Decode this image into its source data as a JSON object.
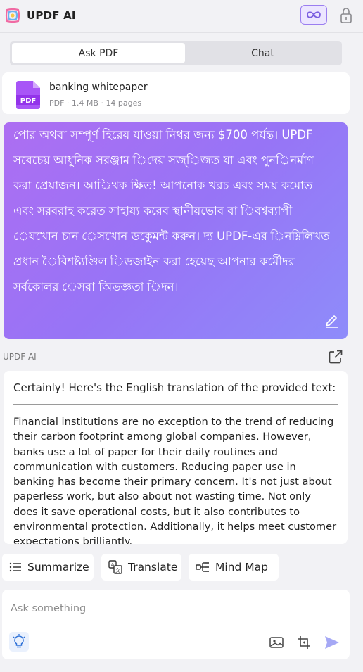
{
  "header": {
    "app_title": "UPDF AI"
  },
  "tabs": [
    {
      "label": "Ask PDF",
      "active": true
    },
    {
      "label": "Chat",
      "active": false
    }
  ],
  "file": {
    "name": "banking whitepaper",
    "meta": "PDF · 1.4 MB · 14 pages",
    "icon_label": "PDF"
  },
  "user_message": {
    "lines": [
      "পোর অথবা সম্পূর্ণ হিরেয় যাওয়া নিথর জন্য $700 পর্যন্ত। UPDF",
      "সবেচেয় আধুনিক সরঞ্জাম িদেয় সজ্িজত যা এবং পুনর্িনর্মাণ",
      "করা প্রেয়াজন। আর্িথক ক্ষিত! আপনােক খরচ এবং সময় কমােত",
      "এবং সরবরাহ করেত সাহায্য করেব স্থানীয়ভােব বা িবশ্বব্যাপী",
      "েযখােন চান েসখােন ডকুেমন্ট করুন। দ্য UPDF-এর িনম্নিলিখত",
      "প্রধান ৈবিশষ্ট্যগুিল িডজাইন করা হেয়েছ আপনার কর্মীেদর",
      "সর্বকােলর েসরা অিভজ্ঞতা িদন।"
    ]
  },
  "ai_response": {
    "label": "UPDF AI",
    "intro": "Certainly! Here's the English translation of the provided text:",
    "body": "Financial institutions are no exception to the trend of reducing their carbon footprint among global companies. However, banks use a lot of paper for their daily routines and communication with customers. Reducing paper use in banking has become their primary concern. It's not just about paperless work, but also about not wasting time. Not only does it save operational costs, but it also contributes to environmental protection. Additionally, it helps meet customer expectations brilliantly."
  },
  "quick_actions": {
    "summarize": "Summarize",
    "translate": "Translate",
    "mind_map": "Mind Map"
  },
  "input": {
    "placeholder": "Ask something",
    "value": ""
  },
  "icons": {
    "logo": "updf-logo-icon",
    "infinity": "infinity-icon",
    "lock": "lock-icon",
    "pdf": "pdf-file-icon",
    "edit": "pencil-icon",
    "share": "share-icon",
    "list": "list-icon",
    "translate": "translate-icon",
    "mindmap": "mind-map-icon",
    "bulb": "lightbulb-icon",
    "image": "image-icon",
    "crop": "crop-icon",
    "send": "send-icon"
  },
  "colors": {
    "accent": "#9b7ef0",
    "bubble_start": "#ad6ef2",
    "bubble_end": "#8e8cfa",
    "pdf_icon": "#a855f7",
    "send": "#a5a8f5"
  }
}
